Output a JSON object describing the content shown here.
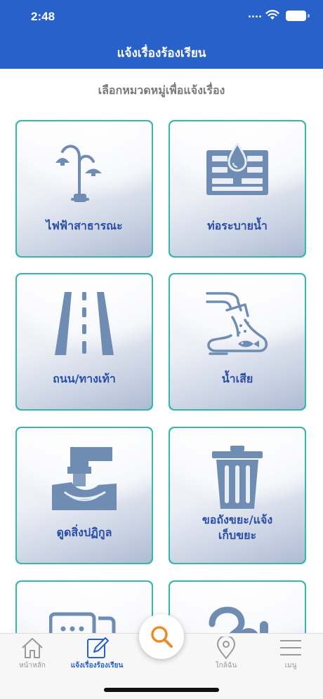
{
  "status_bar": {
    "time": "2:48"
  },
  "header": {
    "title": "แจ้งเรื่องร้องเรียน"
  },
  "subtitle": "เลือกหมวดหมู่เพื่อแจ้งเรื่อง",
  "categories": [
    {
      "label": "ไฟฟ้าสาธารณะ",
      "icon": "street-lamp-icon"
    },
    {
      "label": "ท่อระบายน้ำ",
      "icon": "drain-icon"
    },
    {
      "label": "ถนน/ทางเท้า",
      "icon": "road-icon"
    },
    {
      "label": "น้ำเสีย",
      "icon": "wastewater-icon"
    },
    {
      "label": "ดูดสิ่งปฏิกูล",
      "icon": "sewage-pipe-icon"
    },
    {
      "label": "ขอถังขยะ/แจ้งเก็บขยะ",
      "label_line1": "ขอถังขยะ/แจ้ง",
      "label_line2": "เก็บขยะ",
      "icon": "trash-bin-icon"
    },
    {
      "label": "",
      "icon": "chat-bubbles-icon"
    },
    {
      "label": "",
      "icon": "question-icon"
    }
  ],
  "tabbar": {
    "home": "หน้าหลัก",
    "report": "แจ้งเรื่องร้องเรียน",
    "nearby": "ใกล้ฉัน",
    "menu": "เมนู"
  },
  "colors": {
    "header": "#2761c9",
    "tile_border": "#33b8aa",
    "icon": "#6f8db3",
    "label": "#2a4ea6",
    "search": "#f08a24"
  }
}
